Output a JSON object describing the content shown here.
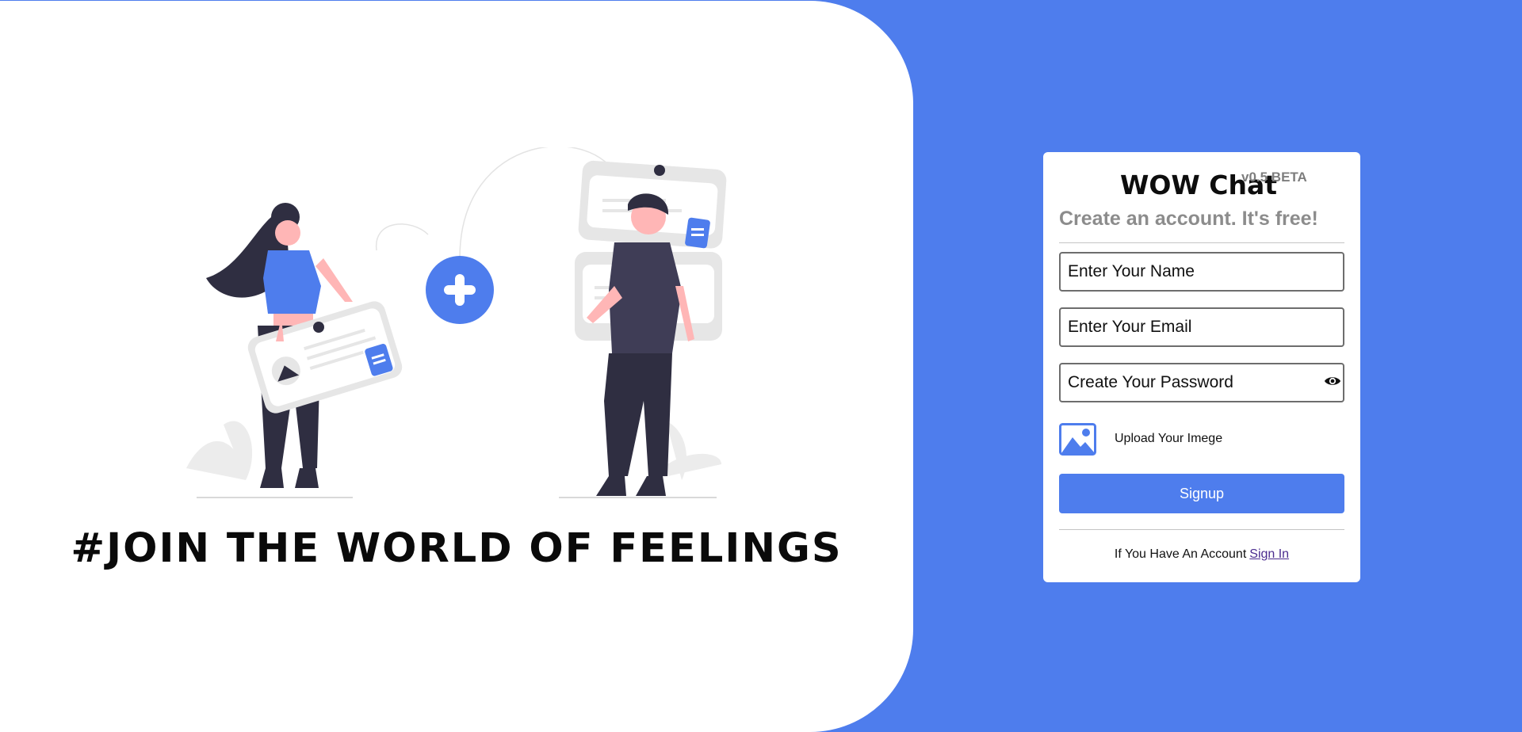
{
  "hero": {
    "tagline": "#JOIN THE WORLD OF FEELINGS",
    "illustration_icon": "people-chat-illustration"
  },
  "form": {
    "title": "WOW Chat",
    "version": "v0.5 BETA",
    "subtitle": "Create an account. It's free!",
    "name_placeholder": "Enter Your Name",
    "email_placeholder": "Enter Your Email",
    "password_placeholder": "Create Your Password",
    "password_toggle_icon": "eye-icon",
    "upload_label": "Upload Your Imege",
    "upload_icon": "image-icon",
    "signup_label": "Signup",
    "signin_prompt": "If You Have An Account",
    "signin_link": "Sign In"
  },
  "colors": {
    "accent": "#4e7ded",
    "panel": "#ffffff",
    "muted_text": "#8c8c8c",
    "link": "#4b2c8f"
  }
}
